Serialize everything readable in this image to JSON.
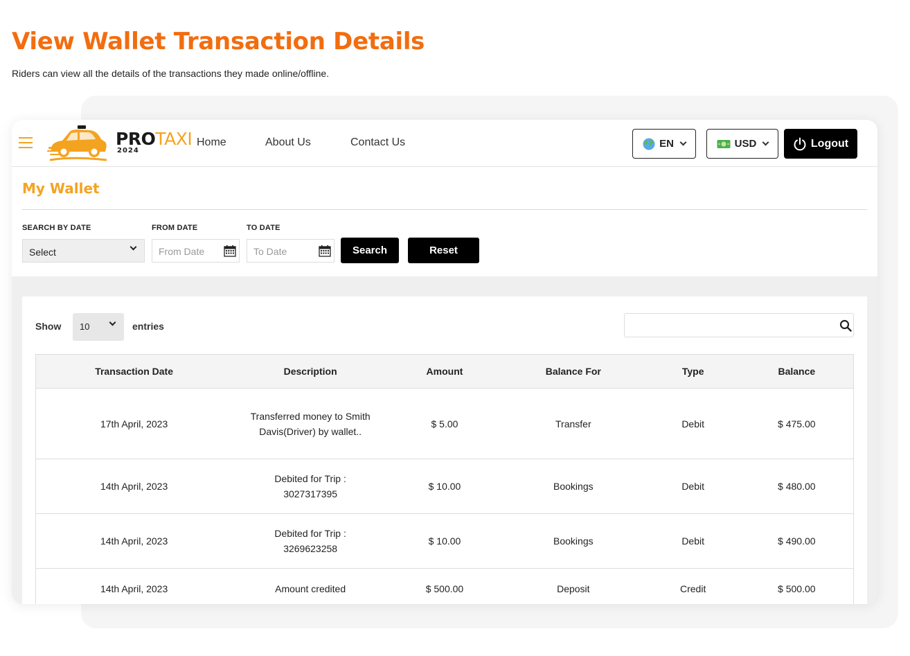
{
  "hero": {
    "title": "View Wallet Transaction Details",
    "subtitle": "Riders can view all the details of the transactions they made online/offline."
  },
  "header": {
    "brand_pro": "PRO",
    "brand_taxi": "TAXI",
    "brand_year": "2024",
    "nav": [
      "Home",
      "About Us",
      "Contact Us"
    ],
    "language": "EN",
    "currency": "USD",
    "logout": "Logout"
  },
  "wallet": {
    "title": "My Wallet",
    "search_by_date_label": "SEARCH BY DATE",
    "select_value": "Select",
    "from_date_label": "FROM DATE",
    "from_date_placeholder": "From Date",
    "to_date_label": "TO DATE",
    "to_date_placeholder": "To Date",
    "search_button": "Search",
    "reset_button": "Reset"
  },
  "table": {
    "show_label": "Show",
    "entries_value": "10",
    "entries_label": "entries",
    "search_value": "",
    "columns": [
      "Transaction Date",
      "Description",
      "Amount",
      "Balance For",
      "Type",
      "Balance"
    ],
    "rows": [
      {
        "date": "17th April, 2023",
        "description": "Transferred money to Smith Davis(Driver) by wallet..",
        "amount": "$ 5.00",
        "balance_for": "Transfer",
        "type": "Debit",
        "balance": "$ 475.00"
      },
      {
        "date": "14th April, 2023",
        "description": "Debited for Trip : 3027317395",
        "amount": "$ 10.00",
        "balance_for": "Bookings",
        "type": "Debit",
        "balance": "$ 480.00"
      },
      {
        "date": "14th April, 2023",
        "description": "Debited for Trip : 3269623258",
        "amount": "$ 10.00",
        "balance_for": "Bookings",
        "type": "Debit",
        "balance": "$ 490.00"
      },
      {
        "date": "14th April, 2023",
        "description": "Amount credited",
        "amount": "$ 500.00",
        "balance_for": "Deposit",
        "type": "Credit",
        "balance": "$ 500.00"
      }
    ]
  },
  "colors": {
    "hero_orange": "#f26d0f",
    "brand_yellow": "#f4a321",
    "button_black": "#000000"
  },
  "icons": [
    "hamburger-menu-icon",
    "taxi-car-logo-icon",
    "globe-icon",
    "usd-banknote-icon",
    "power-icon",
    "calendar-icon",
    "search-icon",
    "chevron-down-icon"
  ]
}
